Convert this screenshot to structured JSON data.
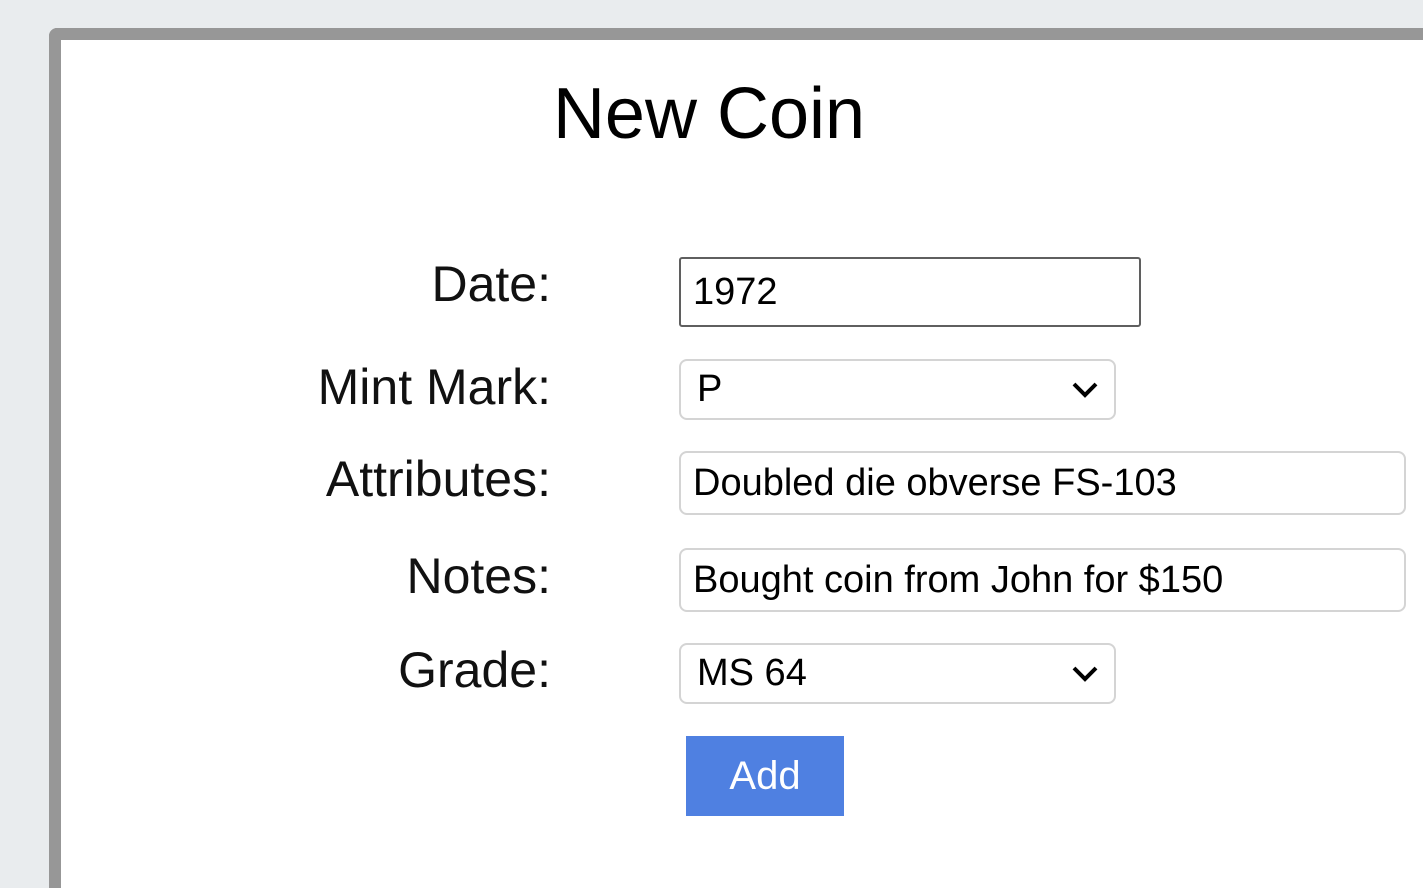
{
  "form": {
    "title": "New Coin",
    "date": {
      "label": "Date:",
      "value": "1972"
    },
    "mint_mark": {
      "label": "Mint Mark:",
      "selected": "P"
    },
    "attributes": {
      "label": "Attributes:",
      "value": "Doubled die obverse FS-103"
    },
    "notes": {
      "label": "Notes:",
      "value": "Bought coin from John for $150"
    },
    "grade": {
      "label": "Grade:",
      "selected": "MS 64"
    },
    "add_label": "Add"
  },
  "colors": {
    "background": "#e9ecee",
    "panel_border": "#979797",
    "button": "#4f80e1"
  },
  "icons": {
    "dropdown": "chevron-down-icon"
  }
}
